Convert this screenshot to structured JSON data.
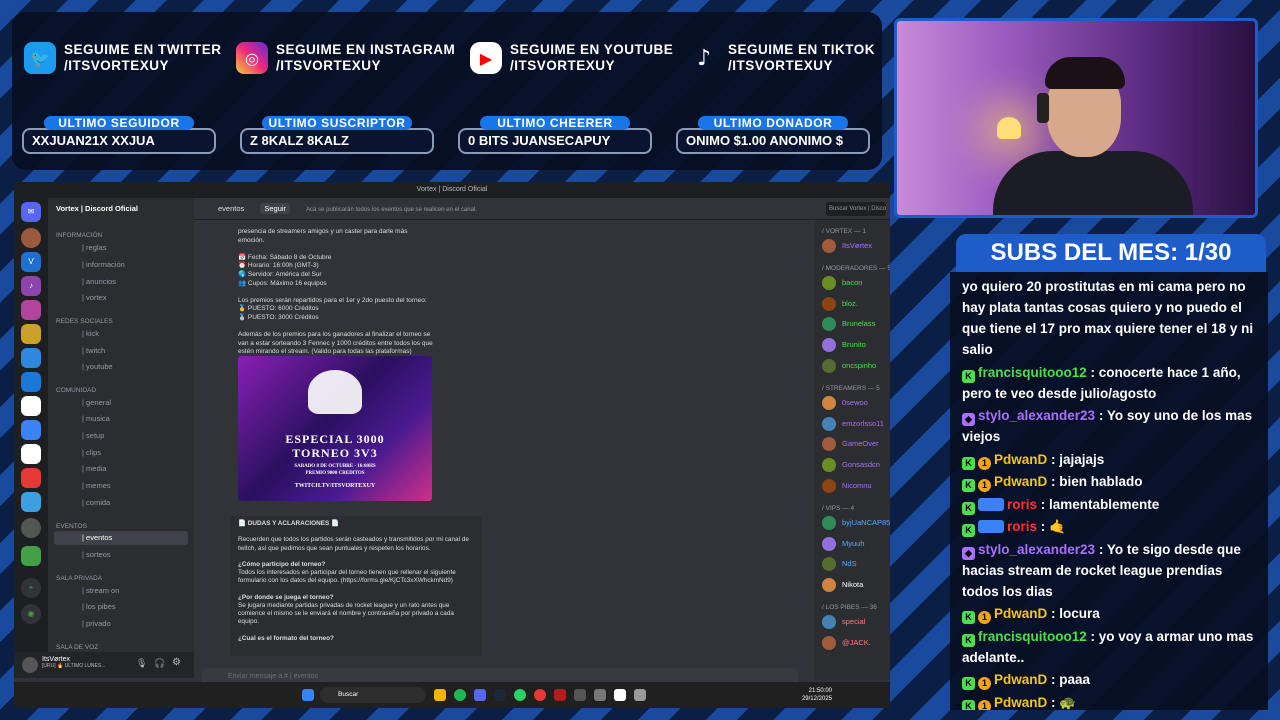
{
  "social": [
    {
      "icon": "twitter-icon",
      "line1": "SEGUIME EN TWITTER",
      "line2": "/ITSVORTEXUY",
      "color": "#1d9bf0"
    },
    {
      "icon": "instagram-icon",
      "line1": "SEGUIME EN INSTAGRAM",
      "line2": "/ITSVORTEXUY",
      "color": "#e1306c"
    },
    {
      "icon": "youtube-icon",
      "line1": "SEGUIME EN YOUTUBE",
      "line2": "/ITSVORTEXUY",
      "color": "#ff0000"
    },
    {
      "icon": "tiktok-icon",
      "line1": "SEGUIME EN TIKTOK",
      "line2": "/ITSVORTEXUY",
      "color": "#000000"
    }
  ],
  "stats": [
    {
      "label": "ULTIMO SEGUIDOR",
      "value": "XXJUAN21X XXJUA"
    },
    {
      "label": "ULTIMO SUSCRIPTOR",
      "value": "Z 8KALZ 8KALZ"
    },
    {
      "label": "ULTIMO CHEERER",
      "value": "0 BITS JUANSECAPUY"
    },
    {
      "label": "ULTIMO DONADOR",
      "value": "ONIMO $1.00 ANONIMO $"
    }
  ],
  "subs_title": "SUBS DEL MES: 1/30",
  "chat": [
    {
      "user": "",
      "color": "#ffffff",
      "text": "yo quiero 20 prostitutas en mi cama pero no hay plata tantas cosas quiero y no puedo el que tiene el 17 pro max quiere tener el 18 y ni salio"
    },
    {
      "user": "francisquitooo12",
      "color": "#4be04b",
      "text": " : conocerte hace 1 año, pero te veo desde julio/agosto"
    },
    {
      "user": "stylo_alexander23",
      "color": "#a970ff",
      "text": " : Yo soy uno de los mas viejos"
    },
    {
      "user": "PdwanD",
      "color": "#f5c518",
      "text": " : jajajajs"
    },
    {
      "user": "PdwanD",
      "color": "#f5c518",
      "text": " : bien hablado"
    },
    {
      "user": "roris",
      "color": "#ff3333",
      "text": " : lamentablemente"
    },
    {
      "user": "roris",
      "color": "#ff3333",
      "text": " : 🤙"
    },
    {
      "user": "stylo_alexander23",
      "color": "#a970ff",
      "text": " : Yo te sigo desde que hacias stream de rocket league prendias todos los dias"
    },
    {
      "user": "PdwanD",
      "color": "#f5c518",
      "text": " : locura"
    },
    {
      "user": "francisquitooo12",
      "color": "#4be04b",
      "text": " : yo voy a armar uno mas adelante.."
    },
    {
      "user": "PdwanD",
      "color": "#f5c518",
      "text": " : paaa"
    },
    {
      "user": "PdwanD",
      "color": "#f5c518",
      "text": " : 🐢"
    },
    {
      "user": "PdwanD",
      "color": "#f5c518",
      "text": " : que locura"
    }
  ],
  "discord": {
    "window_title": "Vortex | Discord Oficial",
    "server_name": "Vortex | Discord Oficial",
    "channel": "eventos",
    "follow": "Seguir",
    "topic": "Acá se publicarán todos los eventos que se realicen en el canal.",
    "search_placeholder": "Buscar Vortex | Disco",
    "categories": [
      "Información",
      "REDES SOCIALES",
      "COMUNIDAD",
      "EVENTOS",
      "SALA PRIVADA",
      "SALA DE VOZ"
    ],
    "channels": [
      "| reglas",
      "| información",
      "| anuncios",
      "| vortex",
      "| kick",
      "| twitch",
      "| youtube",
      "| general",
      "| musica",
      "| setup",
      "| clips",
      "| media",
      "| memes",
      "| comida",
      "| eventos",
      "| sorteos",
      "| stream on",
      "| los pibes",
      "| privado"
    ],
    "content": [
      "presencia de streamers amigos y un caster para darle más",
      "emoción.",
      "",
      "📅 Fecha: Sábado 8 de Octubre",
      "⏰ Horario: 16:00h (GMT-3)",
      "🌎 Servidor: América del Sur",
      "👥 Cupos: Máximo 16 equipos",
      "",
      "Los premios serán repartidos para el 1er y 2do puesto del torneo:",
      "🥇 PUESTO: 6000 Créditos",
      "🥈 PUESTO: 3000 Créditos",
      "",
      "Además de los premios para los ganadores al finalizar el torneo se",
      "van a estar sorteando 3 Fennec y 1000 créditos entre todos los que",
      "estén mirando el stream. (Valido para todas las plataformas)"
    ],
    "poster": {
      "line1": "ESPECIAL 3000",
      "line2": "TORNEO 3V3",
      "line3": "SABADO 8 DE OCTUBRE - 16:00HS",
      "line4": "PREMIO 9000 CREDITOS",
      "line5": "TWITCH.TV/ITSVORTEXUY"
    },
    "faq": [
      "📄 DUDAS Y ACLARACIONES 📄",
      "",
      "Recuerden que todos los partidos serán casteados y transmitidos por mi canal de",
      "twitch, así que pedimos que sean puntuales y respeten los horarios.",
      "",
      "¿Cómo participo del torneo?",
      "Todos los interesados en participar del torneo tienen que rellenar el siguiente",
      "formulario con los datos del equipo. (https://forms.gle/KjCTc3xXWhckmNd9)",
      "",
      "¿Por donde se juega el torneo?",
      "Se jugara mediante partidas privadas de rocket league y un rato antes que",
      "comience el mismo se le enviará el nombre y contraseña por privado a cada",
      "equipo.",
      "",
      "¿Cual es el formato del torneo?"
    ],
    "message_placeholder": "Enviar mensaje a # | eventos",
    "user_name": "ItsVørtex",
    "user_status": "[URU] 🔥 ULTIMO LUNES...",
    "member_groups": [
      {
        "title": "/ VORTEX — 1",
        "members": [
          {
            "name": "ItsVørtex",
            "color": "#a970ff"
          }
        ]
      },
      {
        "title": "/ MODERADORES — 5",
        "members": [
          {
            "name": "bacon",
            "color": "#4be04b"
          },
          {
            "name": "bloz.",
            "color": "#4be04b"
          },
          {
            "name": "Brunelass",
            "color": "#4be04b"
          },
          {
            "name": "Brunito",
            "color": "#4be04b"
          },
          {
            "name": "oncspinho",
            "color": "#4be04b"
          }
        ]
      },
      {
        "title": "/ STREAMERS — 5",
        "members": [
          {
            "name": "0sewoo",
            "color": "#a970ff"
          },
          {
            "name": "emzorlsso11",
            "color": "#a970ff"
          },
          {
            "name": "GameOver",
            "color": "#a970ff"
          },
          {
            "name": "Gonsasdcn",
            "color": "#a970ff"
          },
          {
            "name": "Nicomnu",
            "color": "#a970ff"
          }
        ]
      },
      {
        "title": "/ VIPS — 4",
        "members": [
          {
            "name": "byjUaNCAP85",
            "color": "#5aa9ff"
          },
          {
            "name": "Myuuh",
            "color": "#5aa9ff"
          },
          {
            "name": "NdS",
            "color": "#5aa9ff"
          },
          {
            "name": "Nikota",
            "color": "#ffffff"
          }
        ]
      },
      {
        "title": "/ LOS PIBES — 36",
        "members": [
          {
            "name": "special",
            "color": "#ff7a7a"
          },
          {
            "name": "@JACK.",
            "color": "#ff7a7a"
          }
        ]
      }
    ],
    "taskbar_search": "Buscar",
    "time": "21:50:00",
    "date": "29/12/2025"
  }
}
